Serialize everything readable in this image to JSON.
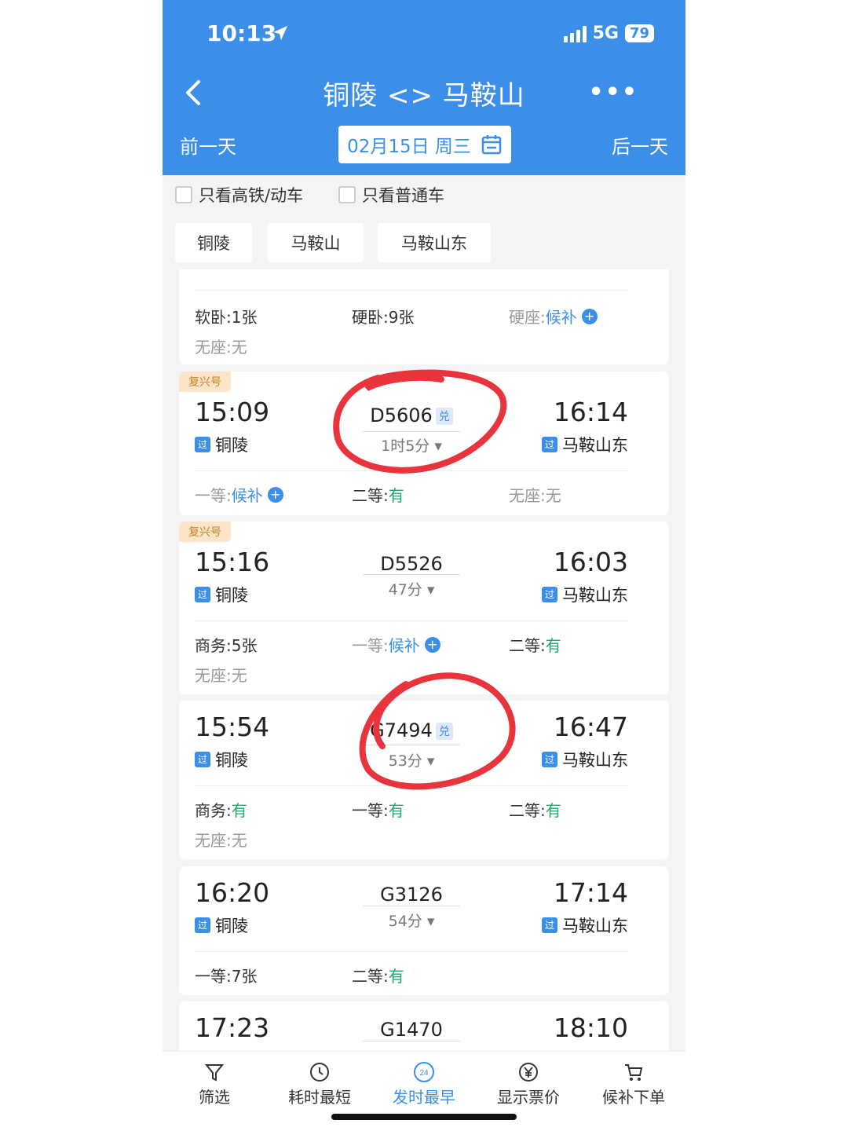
{
  "status": {
    "time": "10:13",
    "network": "5G",
    "battery": "79"
  },
  "header": {
    "title": "铜陵 <> 马鞍山",
    "prev_day": "前一天",
    "next_day": "后一天",
    "date": "02月15日 周三"
  },
  "filters": {
    "high_speed_only": "只看高铁/动车",
    "normal_only": "只看普通车"
  },
  "stations": [
    "铜陵",
    "马鞍山",
    "马鞍山东"
  ],
  "trains": [
    {
      "seats_row1": [
        {
          "label": "软卧: ",
          "value": "1张",
          "kind": "normal"
        },
        {
          "label": "硬卧: ",
          "value": "9张",
          "kind": "normal"
        },
        {
          "label": "硬座: ",
          "value": "候补",
          "kind": "wait"
        }
      ],
      "seats_row2": [
        {
          "label": "无座: ",
          "value": "无",
          "kind": "gray"
        }
      ]
    },
    {
      "tag": "复兴号",
      "dep_time": "15:09",
      "dep_station": "铜陵",
      "train_no": "D5606",
      "dui": "兑",
      "duration": "1时5分",
      "arr_time": "16:14",
      "arr_station": "马鞍山东",
      "seats_row1": [
        {
          "label": "一等: ",
          "value": "候补",
          "kind": "wait"
        },
        {
          "label": "二等: ",
          "value": "有",
          "kind": "avail"
        },
        {
          "label": "无座: ",
          "value": "无",
          "kind": "gray"
        }
      ]
    },
    {
      "tag": "复兴号",
      "dep_time": "15:16",
      "dep_station": "铜陵",
      "train_no": "D5526",
      "duration": "47分",
      "arr_time": "16:03",
      "arr_station": "马鞍山东",
      "seats_row1": [
        {
          "label": "商务: ",
          "value": "5张",
          "kind": "normal"
        },
        {
          "label": "一等: ",
          "value": "候补",
          "kind": "wait"
        },
        {
          "label": "二等: ",
          "value": "有",
          "kind": "avail"
        }
      ],
      "seats_row2": [
        {
          "label": "无座: ",
          "value": "无",
          "kind": "gray"
        }
      ]
    },
    {
      "dep_time": "15:54",
      "dep_station": "铜陵",
      "train_no": "G7494",
      "dui": "兑",
      "duration": "53分",
      "arr_time": "16:47",
      "arr_station": "马鞍山东",
      "seats_row1": [
        {
          "label": "商务: ",
          "value": "有",
          "kind": "avail"
        },
        {
          "label": "一等: ",
          "value": "有",
          "kind": "avail"
        },
        {
          "label": "二等: ",
          "value": "有",
          "kind": "avail"
        }
      ],
      "seats_row2": [
        {
          "label": "无座: ",
          "value": "无",
          "kind": "gray"
        }
      ]
    },
    {
      "dep_time": "16:20",
      "dep_station": "铜陵",
      "train_no": "G3126",
      "duration": "54分",
      "arr_time": "17:14",
      "arr_station": "马鞍山东",
      "seats_row1": [
        {
          "label": "一等: ",
          "value": "7张",
          "kind": "normal"
        },
        {
          "label": "二等: ",
          "value": "有",
          "kind": "avail"
        }
      ]
    },
    {
      "dep_time": "17:23",
      "train_no": "G1470",
      "arr_time": "18:10"
    }
  ],
  "badge_label": "过",
  "tabbar": [
    "筛选",
    "耗时最短",
    "发时最早",
    "显示票价",
    "候补下单"
  ],
  "tabbar_early_badge": "24",
  "colors": {
    "primary": "#3b8fe8",
    "available": "#1aaa6b",
    "annotation": "#e8343c"
  }
}
